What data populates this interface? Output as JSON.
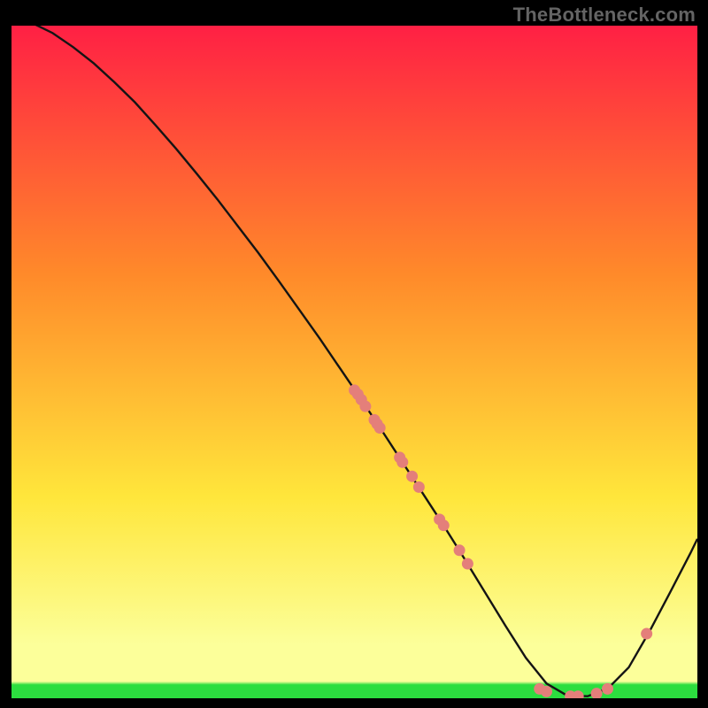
{
  "attribution": "TheBottleneck.com",
  "colors": {
    "background": "#000000",
    "gradient_top": "#ff2044",
    "gradient_mid_upper": "#ff8a2a",
    "gradient_mid": "#ffe63b",
    "gradient_lower_band": "#fcff9a",
    "gradient_green": "#2cde3f",
    "curve_stroke": "#141414",
    "marker_fill": "#e47f7a"
  },
  "chart_data": {
    "type": "line",
    "title": "",
    "xlabel": "",
    "ylabel": "",
    "xlim": [
      0,
      100
    ],
    "ylim": [
      0,
      100
    ],
    "grid": false,
    "legend": false,
    "series": [
      {
        "name": "curve",
        "x": [
          0,
          3,
          6,
          9,
          12,
          15,
          18,
          21,
          24,
          27,
          30,
          33,
          36,
          39,
          42,
          45,
          48,
          51,
          54,
          57,
          60,
          63,
          66,
          69,
          72,
          75,
          78,
          81,
          84,
          87,
          90,
          93,
          96,
          99,
          100
        ],
        "y": [
          101.5,
          100.4,
          98.9,
          96.8,
          94.4,
          91.6,
          88.6,
          85.2,
          81.7,
          78.0,
          74.2,
          70.2,
          66.2,
          62.0,
          57.7,
          53.4,
          48.9,
          44.4,
          39.8,
          35.1,
          30.4,
          25.7,
          20.8,
          15.8,
          10.8,
          6.0,
          2.2,
          0.4,
          0.3,
          1.5,
          4.6,
          9.9,
          15.7,
          21.6,
          23.7
        ]
      }
    ],
    "markers": {
      "name": "highlighted-points",
      "x": [
        50.0,
        50.5,
        51.0,
        51.6,
        52.9,
        53.3,
        53.7,
        56.6,
        57.0,
        58.4,
        59.4,
        62.4,
        63.0,
        65.3,
        66.5,
        77.0,
        78.0,
        81.5,
        82.6,
        85.3,
        86.9,
        92.6
      ],
      "y": [
        45.8,
        45.2,
        44.4,
        43.4,
        41.4,
        40.8,
        40.2,
        35.8,
        35.1,
        33.0,
        31.4,
        26.6,
        25.7,
        22.0,
        20.0,
        1.4,
        1.0,
        0.3,
        0.3,
        0.7,
        1.4,
        9.6
      ]
    }
  }
}
